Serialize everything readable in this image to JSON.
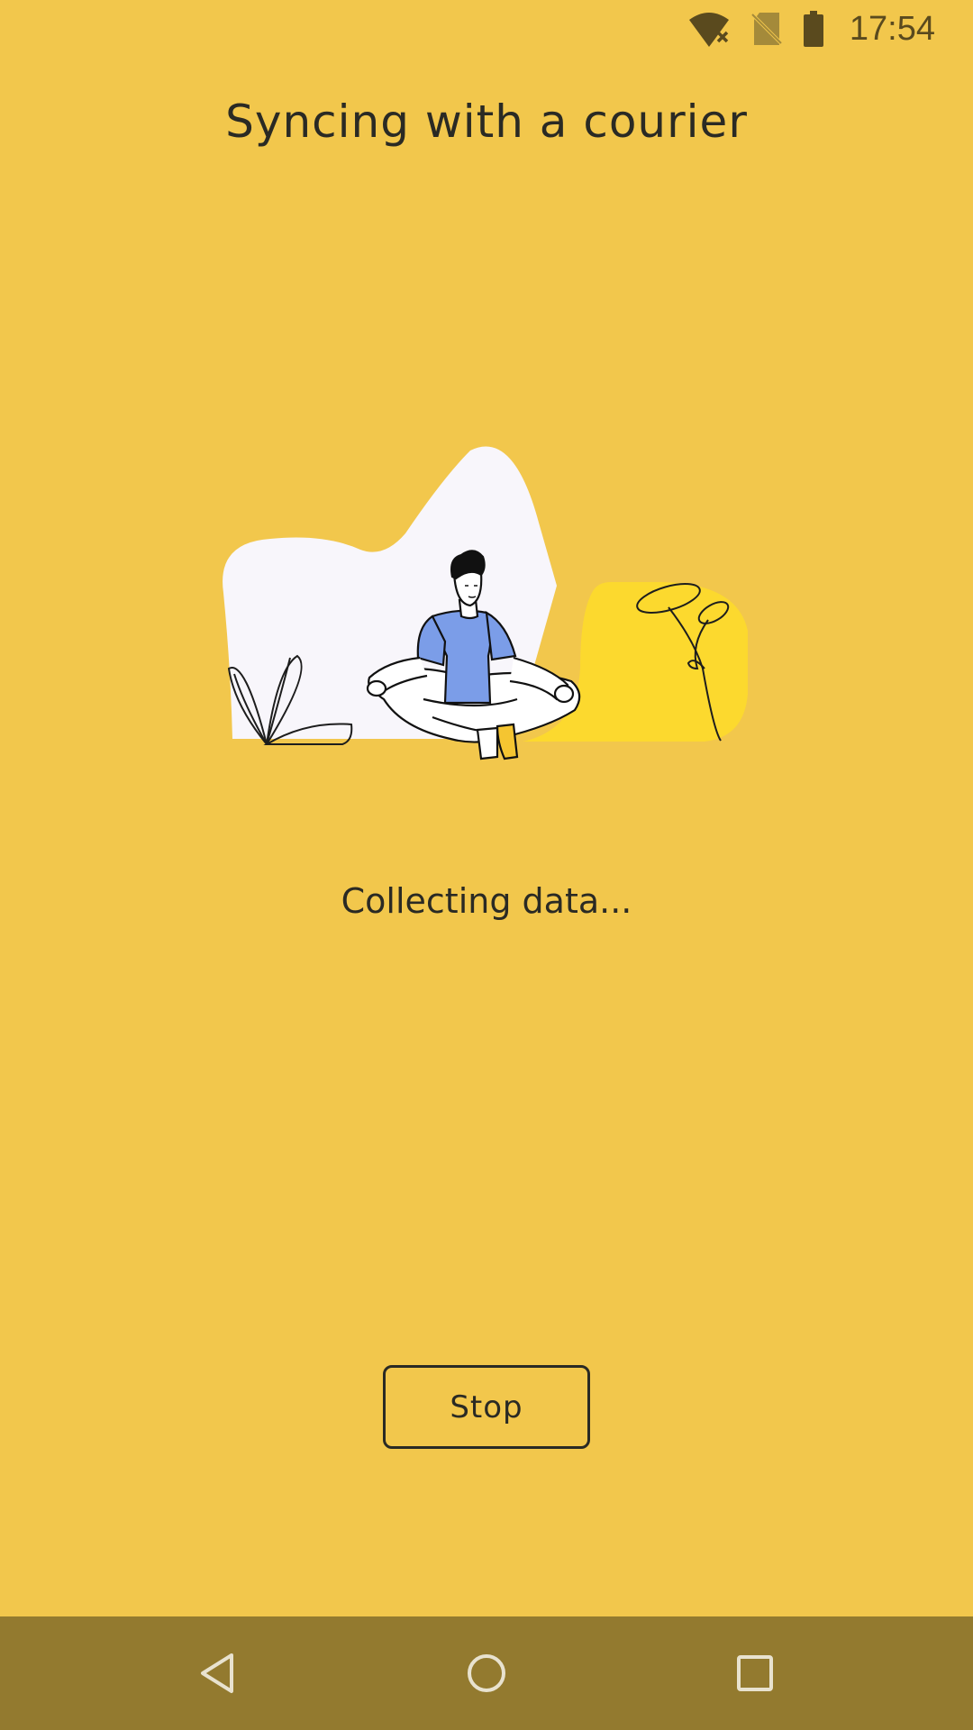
{
  "status_bar": {
    "time": "17:54",
    "icons": [
      "wifi-off-icon",
      "no-sim-icon",
      "battery-icon"
    ]
  },
  "header": {
    "title": "Syncing with a courier"
  },
  "illustration": {
    "subject": "person-meditating-illustration"
  },
  "main": {
    "progress_text": "Collecting data...",
    "stop_label": "Stop"
  },
  "nav_bar": {
    "buttons": [
      "back-icon",
      "home-icon",
      "recents-icon"
    ]
  },
  "colors": {
    "background": "#f2c74c",
    "nav_bar": "#937a2f",
    "text": "#2a2a24",
    "shirt": "#7b9de8",
    "blob_light": "#f8f6fb",
    "blob_yellow": "#fcd92e"
  }
}
